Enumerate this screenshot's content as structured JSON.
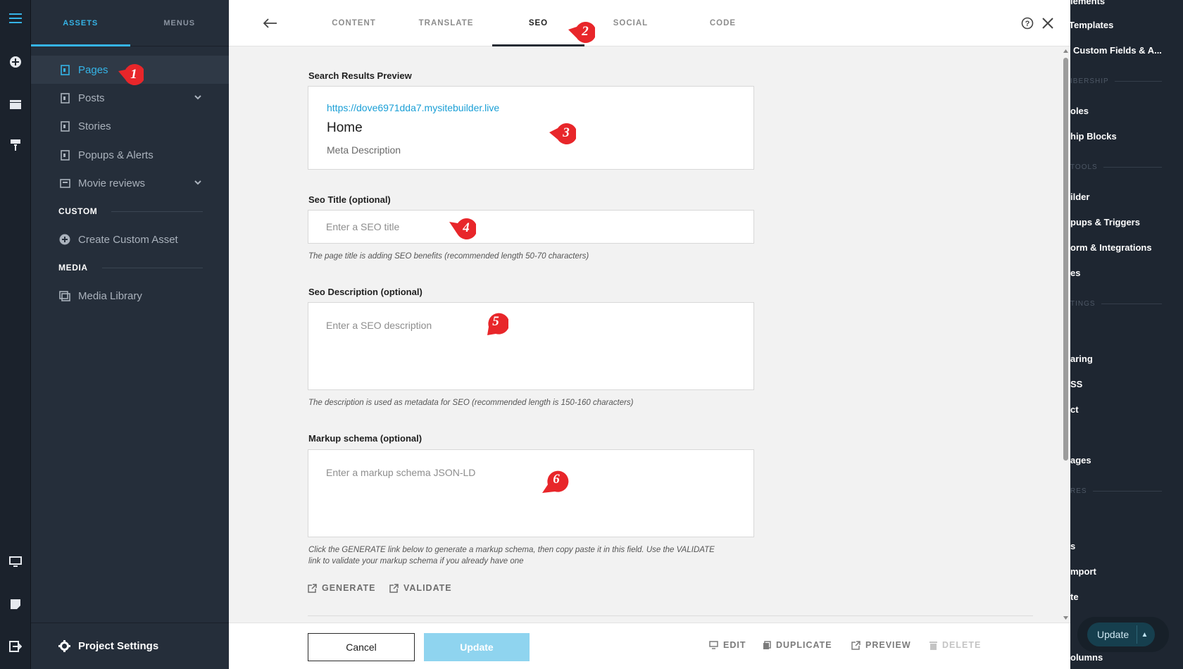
{
  "assets_panel": {
    "tabs": [
      {
        "label": "ASSETS",
        "active": true
      },
      {
        "label": "MENUS",
        "active": false
      }
    ],
    "items": [
      {
        "label": "Pages",
        "icon": "page-icon",
        "active": true,
        "has_chevron": false
      },
      {
        "label": "Posts",
        "icon": "page-icon",
        "active": false,
        "has_chevron": true
      },
      {
        "label": "Stories",
        "icon": "page-icon",
        "active": false,
        "has_chevron": false
      },
      {
        "label": "Popups & Alerts",
        "icon": "page-icon",
        "active": false,
        "has_chevron": false
      },
      {
        "label": "Movie reviews",
        "icon": "collection-icon",
        "active": false,
        "has_chevron": true
      }
    ],
    "custom_section": "CUSTOM",
    "create_custom_asset": "Create Custom Asset",
    "media_section": "MEDIA",
    "media_library": "Media Library",
    "project_settings": "Project Settings"
  },
  "modal": {
    "tabs": [
      {
        "label": "CONTENT",
        "active": false
      },
      {
        "label": "TRANSLATE",
        "active": false
      },
      {
        "label": "SEO",
        "active": true
      },
      {
        "label": "SOCIAL",
        "active": false
      },
      {
        "label": "CODE",
        "active": false
      }
    ],
    "search_preview": {
      "label": "Search Results Preview",
      "url": "https://dove6971dda7.mysitebuilder.live",
      "title": "Home",
      "description": "Meta Description"
    },
    "seo_title": {
      "label": "Seo Title (optional)",
      "value": "",
      "placeholder": "Enter a SEO title",
      "hint": "The page title is adding SEO benefits (recommended length 50-70 characters)"
    },
    "seo_description": {
      "label": "Seo Description (optional)",
      "value": "",
      "placeholder": "Enter a SEO description",
      "hint": "The description is used as metadata for SEO (recommended length is 150-160 characters)"
    },
    "markup_schema": {
      "label": "Markup schema (optional)",
      "value": "",
      "placeholder": "Enter a markup schema JSON-LD",
      "hint_line1": "Click the GENERATE link below to generate a markup schema, then copy paste it in this field. Use the VALIDATE",
      "hint_line2": "link to validate your markup schema if you already have one",
      "generate": "GENERATE",
      "validate": "VALIDATE"
    },
    "footer": {
      "cancel": "Cancel",
      "update": "Update",
      "edit": "EDIT",
      "duplicate": "DUPLICATE",
      "preview": "PREVIEW",
      "delete": "DELETE"
    }
  },
  "annotations": [
    "1",
    "2",
    "3",
    "4",
    "5",
    "6"
  ],
  "right_panel": {
    "items": [
      "lements",
      "Templates",
      "Custom Fields & A...",
      "oles",
      "hip Blocks",
      "ilder",
      "pups & Triggers",
      "orm & Integrations",
      "es",
      "aring",
      "SS",
      "ct",
      "ages",
      "s",
      "mport",
      "te",
      "olumns"
    ],
    "sections": [
      "IBERSHIP",
      "TOOLS",
      "TINGS",
      "RES"
    ],
    "update_button": "Update"
  },
  "colors": {
    "accent": "#35b4e7",
    "annotation_red": "#e8262a",
    "sidebar_bg": "#252e3a",
    "rail_bg": "#1b222c"
  }
}
